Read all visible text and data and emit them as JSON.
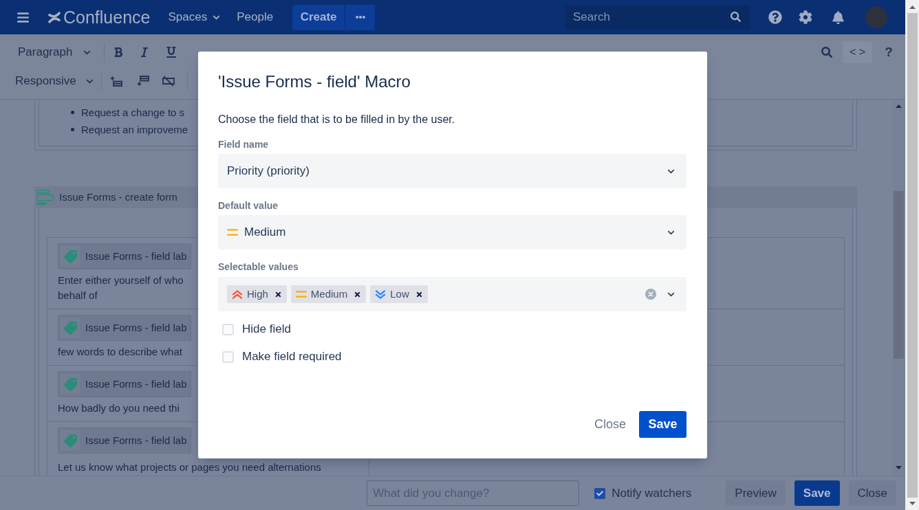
{
  "nav": {
    "brand": "Confluence",
    "links": [
      {
        "label": "Spaces",
        "kind": "menu"
      },
      {
        "label": "People",
        "kind": "link"
      }
    ],
    "create_button": "Create",
    "search": {
      "placeholder": "Search"
    }
  },
  "toolbar": {
    "style_select": "Paragraph",
    "layout_select": "Responsive",
    "source_button": "< >",
    "help_button": "?"
  },
  "page": {
    "bullets": [
      "Request a change to s",
      "Request an improveme"
    ],
    "macro": {
      "title": "Issue Forms - create form",
      "rows": [
        {
          "label": "Issue Forms - field lab",
          "text_lines": [
            "Enter either yourself of who",
            "behalf of"
          ]
        },
        {
          "label": "Issue Forms - field lab",
          "text_lines": [
            "few words to describe what"
          ]
        },
        {
          "label": "Issue Forms - field lab",
          "text_lines": [
            "How badly do you need thi"
          ]
        },
        {
          "label": "Issue Forms - field lab",
          "text_lines": [
            "Let us know what projects or pages you need alternations"
          ]
        }
      ]
    }
  },
  "dialog": {
    "title": "'Issue Forms - field' Macro",
    "description": "Choose the field that is to be filled in by the user.",
    "fields": [
      {
        "kind": "select",
        "label": "Field name",
        "value": {
          "label": "Priority (priority)"
        }
      },
      {
        "kind": "select",
        "label": "Default value",
        "value": {
          "label": "Medium",
          "kind": "medium"
        }
      },
      {
        "kind": "multi_select",
        "label": "Selectable values",
        "tags": [
          {
            "label": "High",
            "kind": "high"
          },
          {
            "label": "Medium",
            "kind": "medium"
          },
          {
            "label": "Low",
            "kind": "low"
          }
        ]
      }
    ],
    "checkboxes": [
      {
        "label": "Hide field",
        "checked": false
      },
      {
        "label": "Make field required",
        "checked": false
      }
    ],
    "buttons": [
      {
        "label": "Close",
        "kind": "subtle"
      },
      {
        "label": "Save",
        "kind": "primary"
      }
    ]
  },
  "footer": {
    "comment": {
      "placeholder": "What did you change?"
    },
    "notify": {
      "label": "Notify watchers",
      "checked": true
    },
    "buttons": [
      {
        "label": "Preview",
        "kind": "default"
      },
      {
        "label": "Save",
        "kind": "primary"
      },
      {
        "label": "Close",
        "kind": "default"
      }
    ]
  }
}
